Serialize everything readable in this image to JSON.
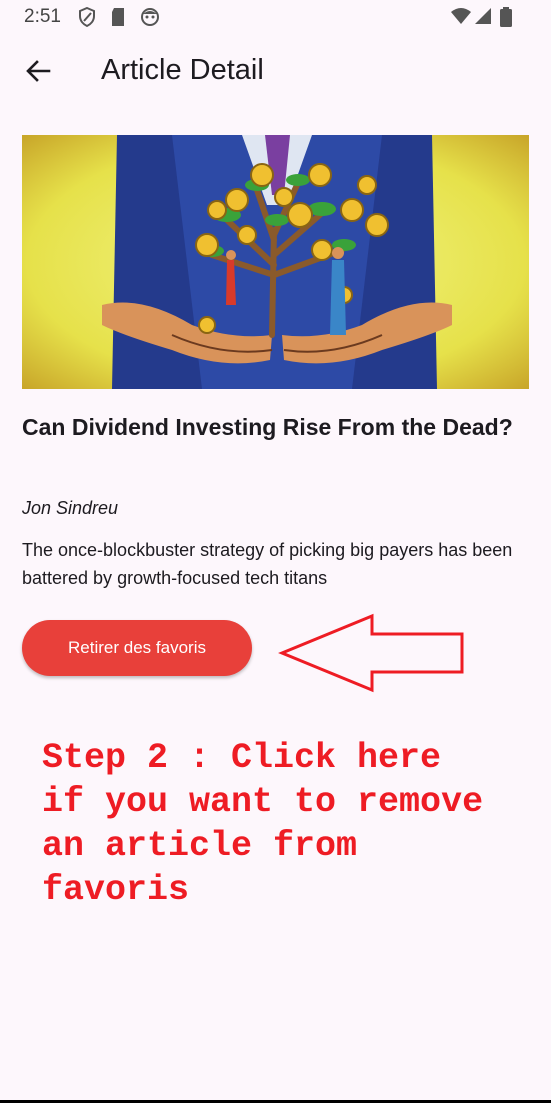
{
  "status_bar": {
    "time": "2:51",
    "icons": [
      "shield-icon",
      "sd-card-icon",
      "face-icon",
      "wifi-icon",
      "signal-icon",
      "battery-icon"
    ]
  },
  "app_bar": {
    "title": "Article Detail",
    "back_icon": "arrow-back-icon"
  },
  "article": {
    "image": "illustration-hands-holding-money-tree",
    "title": "Can Dividend Investing Rise From the Dead?",
    "author": "Jon Sindreu",
    "summary": "The once-blockbuster strategy of picking big payers has been battered by growth-focused tech titans"
  },
  "actions": {
    "remove_favorite_label": "Retirer des favoris"
  },
  "annotation": {
    "text": "Step 2 : Click here\nif you want to remove\nan article from\nfavoris",
    "color": "#ee1c24"
  },
  "colors": {
    "accent": "#e8403a",
    "background": "#fdf7fc"
  }
}
